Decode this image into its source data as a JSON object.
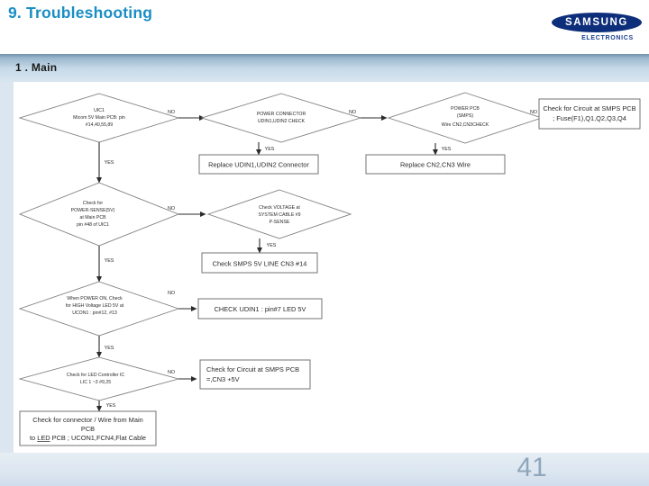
{
  "header": {
    "title": "9. Troubleshooting",
    "brand": "SAMSUNG",
    "brand_sub": "ELECTRONICS"
  },
  "section": {
    "label": "1 . Main"
  },
  "footer": {
    "page_number": "41"
  },
  "labels": {
    "yes": "YES",
    "no": "NO"
  },
  "flow": {
    "d1": {
      "l1": "UIC1",
      "l2": "Micom 5V Main PCB: pin",
      "l3": "#14,40,55,89"
    },
    "d2": {
      "l1": "POWER CONNECTOR",
      "l2": "UDIN1,UDIN2 CHECK"
    },
    "d3": {
      "l1": "POWER PCB",
      "l2": "(SMPS)",
      "l3": "Wire CN2,CN3CHECK"
    },
    "d4": {
      "l1": "Check for",
      "l2": "POWER-SENSE(5V)",
      "l3": "at Main PCB",
      "l4": "pin #48 of UIC1"
    },
    "d5": {
      "l1": "Check  VOLTAGE at",
      "l2": "SYSTEM CABLE #9",
      "l3": "P-SENSE"
    },
    "d6": {
      "l1": "When POWER ON, Check",
      "l2": "for HIGH Voltage LED 5V at",
      "l3": "UCON1 : pin#12, #13"
    },
    "d7": {
      "l1": "Check for LED Controller IC",
      "l2": "LIC 1 ~3 #9,25"
    },
    "b1": {
      "l1": "Check for Circuit at SMPS PCB",
      "l2": "; Fuse(F1),Q1,Q2,Q3,Q4"
    },
    "b2": {
      "l1": "Replace UDIN1,UDIN2 Connector"
    },
    "b3": {
      "l1": "Replace CN2,CN3 Wire"
    },
    "b4": {
      "l1": "Check SMPS 5V LINE CN3 #14"
    },
    "b5": {
      "l1": "CHECK UDIN1 : pin#7 LED 5V"
    },
    "b6": {
      "l1": "Check for Circuit at SMPS PCB",
      "l2": "=,CN3 +5V"
    },
    "b7": {
      "l1": "Check for connector / Wire from  Main",
      "l2": "PCB",
      "l3_a": "to ",
      "l3_b": "LED",
      "l3_c": " PCB ; UCON1,FCN4,Flat Cable"
    }
  }
}
